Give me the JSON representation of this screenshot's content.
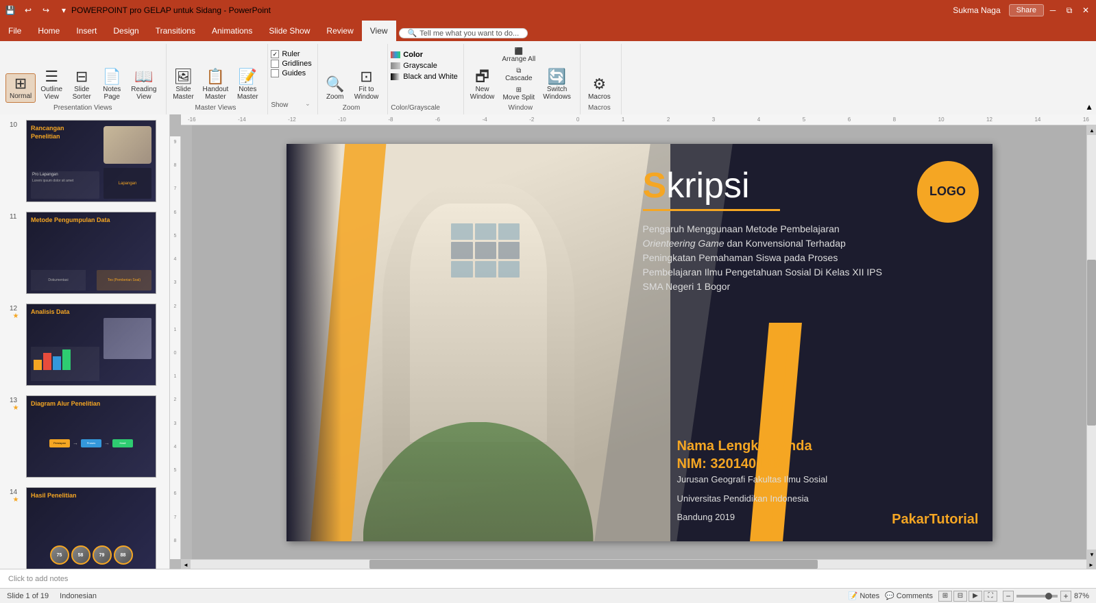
{
  "titleBar": {
    "title": "POWERPOINT pro GELAP untuk Sidang - PowerPoint",
    "quickAccess": [
      "save",
      "undo",
      "redo",
      "customize"
    ],
    "winControls": [
      "minimize",
      "restore",
      "close"
    ]
  },
  "ribbonTabs": [
    {
      "id": "file",
      "label": "File"
    },
    {
      "id": "home",
      "label": "Home"
    },
    {
      "id": "insert",
      "label": "Insert"
    },
    {
      "id": "design",
      "label": "Design"
    },
    {
      "id": "transitions",
      "label": "Transitions"
    },
    {
      "id": "animations",
      "label": "Animations"
    },
    {
      "id": "slideshow",
      "label": "Slide Show"
    },
    {
      "id": "review",
      "label": "Review"
    },
    {
      "id": "view",
      "label": "View",
      "active": true
    }
  ],
  "ribbon": {
    "tellMe": "Tell me what you want to do...",
    "groups": {
      "presentationViews": {
        "label": "Presentation Views",
        "buttons": [
          {
            "id": "normal",
            "icon": "⊞",
            "label": "Normal"
          },
          {
            "id": "outline",
            "icon": "≡",
            "label": "Outline\nView"
          },
          {
            "id": "slide-sorter",
            "icon": "⊟",
            "label": "Slide\nSorter"
          },
          {
            "id": "notes-page",
            "icon": "📄",
            "label": "Notes\nPage"
          },
          {
            "id": "reading",
            "icon": "📖",
            "label": "Reading\nView"
          }
        ]
      },
      "masterViews": {
        "label": "Master Views",
        "buttons": [
          {
            "id": "slide-master",
            "icon": "🖼",
            "label": "Slide\nMaster"
          },
          {
            "id": "handout-master",
            "icon": "📋",
            "label": "Handout\nMaster"
          },
          {
            "id": "notes-master",
            "icon": "📝",
            "label": "Notes\nMaster"
          }
        ]
      },
      "show": {
        "label": "Show",
        "checkboxes": [
          {
            "id": "ruler",
            "label": "Ruler",
            "checked": true
          },
          {
            "id": "gridlines",
            "label": "Gridlines",
            "checked": false
          },
          {
            "id": "guides",
            "label": "Guides",
            "checked": false
          }
        ]
      },
      "zoom": {
        "label": "Zoom",
        "buttons": [
          {
            "id": "zoom-btn",
            "icon": "🔍",
            "label": "Zoom"
          },
          {
            "id": "fit-window",
            "icon": "⊡",
            "label": "Fit to\nWindow"
          }
        ]
      },
      "colorGrayscale": {
        "label": "Color/Grayscale",
        "options": [
          {
            "id": "color",
            "label": "Color",
            "active": true
          },
          {
            "id": "grayscale",
            "label": "Grayscale"
          },
          {
            "id": "bw",
            "label": "Black and White"
          }
        ]
      },
      "window": {
        "label": "Window",
        "buttons": [
          {
            "id": "new-window",
            "icon": "🗗",
            "label": "New\nWindow"
          },
          {
            "id": "arrange",
            "icon": "⬛",
            "label": "Arrange All"
          },
          {
            "id": "cascade",
            "icon": "⧉",
            "label": "Cascade"
          },
          {
            "id": "move-split",
            "icon": "⊞",
            "label": "Move Split"
          },
          {
            "id": "switch",
            "icon": "🔄",
            "label": "Switch\nWindows"
          }
        ]
      },
      "macros": {
        "label": "Macros",
        "buttons": [
          {
            "id": "macros-btn",
            "icon": "⚙",
            "label": "Macros"
          }
        ]
      }
    }
  },
  "user": {
    "name": "Sukma Naga",
    "shareLabel": "Share"
  },
  "slides": [
    {
      "num": "10",
      "title": "Rancangan Penelitian",
      "hasTitle": true,
      "star": false
    },
    {
      "num": "11",
      "title": "Metode Pengumpulan Data",
      "hasTitle": true,
      "star": false
    },
    {
      "num": "12",
      "title": "Analisis Data",
      "hasTitle": true,
      "star": true
    },
    {
      "num": "13",
      "title": "Diagram Alur Penelitian",
      "hasTitle": true,
      "star": true
    },
    {
      "num": "14",
      "title": "Hasil Penelitian",
      "hasTitle": true,
      "star": true
    }
  ],
  "mainSlide": {
    "logoText": "LOGO",
    "titlePrefix": "S",
    "titleRest": "kripsi",
    "subtitle": "Pengaruh Menggunaan Metode Pembelajaran Orienteering Game dan Konvensional Terhadap Peningkatan Pemahaman Siswa pada Proses Pembelajaran Ilmu Pengetahuan Sosial Di Kelas XII IPS SMA Negeri 1 Bogor",
    "name": "Nama Lengkap Anda",
    "nim": "NIM: 3201401965",
    "institution1": "Jurusan Geografi  Fakultas Ilmu Sosial",
    "institution2": "Universitas Pendidikan Indonesia",
    "institution3": "Bandung 2019",
    "brand1": "Pakar",
    "brand2": "Tutorial"
  },
  "statusBar": {
    "slideInfo": "Slide 1 of 19",
    "language": "Indonesian",
    "notesLabel": "Notes",
    "commentsLabel": "Comments",
    "zoomLevel": "87%"
  },
  "notes": {
    "placeholder": "Click to add notes"
  }
}
